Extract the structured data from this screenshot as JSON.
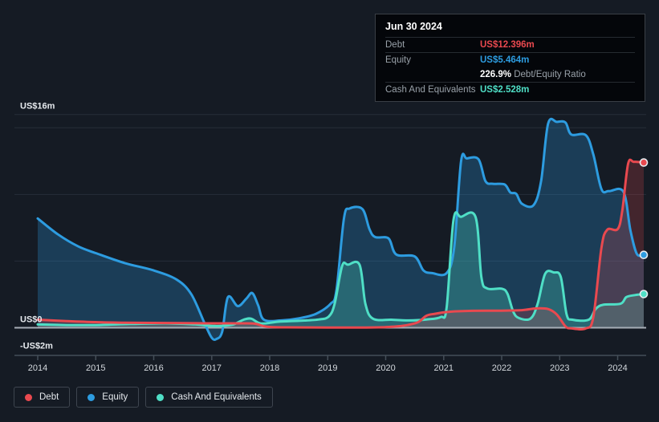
{
  "tooltip": {
    "date": "Jun 30 2024",
    "rows": [
      {
        "label": "Debt",
        "value": "US$12.396m"
      },
      {
        "label": "Equity",
        "value": "US$5.464m"
      },
      {
        "ratio_value": "226.9%",
        "ratio_label": "Debt/Equity Ratio"
      },
      {
        "label": "Cash And Equivalents",
        "value": "US$2.528m"
      }
    ]
  },
  "chart_data": {
    "type": "area",
    "unit": "US$ millions",
    "x_axis": {
      "ticks": [
        2014,
        2015,
        2016,
        2017,
        2018,
        2019,
        2020,
        2021,
        2022,
        2023,
        2024
      ],
      "range": [
        2014,
        2024.5
      ]
    },
    "y_axis": {
      "labels": [
        {
          "text": "US$16m",
          "value": 16
        },
        {
          "text": "US$0",
          "value": 0
        },
        {
          "text": "-US$2m",
          "value": -2
        }
      ],
      "gridline_values": [
        16,
        15,
        10,
        5
      ],
      "range": [
        -2.1,
        17.7
      ]
    },
    "legend_position": "bottom-left",
    "series": [
      {
        "name": "Debt",
        "color": "#e9494f",
        "points": [
          [
            2014,
            0.6
          ],
          [
            2014.5,
            0.5
          ],
          [
            2015,
            0.42
          ],
          [
            2015.5,
            0.38
          ],
          [
            2016,
            0.36
          ],
          [
            2016.5,
            0.35
          ],
          [
            2017,
            0.33
          ],
          [
            2017.5,
            0.33
          ],
          [
            2017.75,
            0.3
          ],
          [
            2017.95,
            0.07
          ],
          [
            2018.3,
            0.03
          ],
          [
            2019,
            0.02
          ],
          [
            2019.6,
            0.02
          ],
          [
            2020,
            0.05
          ],
          [
            2020.3,
            0.15
          ],
          [
            2020.55,
            0.4
          ],
          [
            2020.7,
            0.9
          ],
          [
            2020.85,
            1.05
          ],
          [
            2021.1,
            1.2
          ],
          [
            2021.5,
            1.27
          ],
          [
            2022,
            1.28
          ],
          [
            2022.35,
            1.32
          ],
          [
            2022.6,
            1.45
          ],
          [
            2022.8,
            1.4
          ],
          [
            2022.95,
            1.0
          ],
          [
            2023.1,
            0.1
          ],
          [
            2023.2,
            -0.05
          ],
          [
            2023.45,
            -0.05
          ],
          [
            2023.58,
            0.8
          ],
          [
            2023.72,
            6.0
          ],
          [
            2023.82,
            7.35
          ],
          [
            2024,
            7.4
          ],
          [
            2024.08,
            8.8
          ],
          [
            2024.18,
            12.3
          ],
          [
            2024.28,
            12.45
          ],
          [
            2024.45,
            12.396
          ]
        ]
      },
      {
        "name": "Equity",
        "color": "#2d9ce0",
        "points": [
          [
            2014,
            8.2
          ],
          [
            2014.35,
            7.0
          ],
          [
            2014.7,
            6.1
          ],
          [
            2015,
            5.6
          ],
          [
            2015.5,
            4.85
          ],
          [
            2016,
            4.3
          ],
          [
            2016.4,
            3.6
          ],
          [
            2016.65,
            2.5
          ],
          [
            2016.88,
            0.3
          ],
          [
            2017,
            -0.75
          ],
          [
            2017.08,
            -0.85
          ],
          [
            2017.18,
            -0.3
          ],
          [
            2017.28,
            2.3
          ],
          [
            2017.45,
            1.62
          ],
          [
            2017.6,
            2.2
          ],
          [
            2017.7,
            2.6
          ],
          [
            2017.8,
            1.7
          ],
          [
            2017.9,
            0.6
          ],
          [
            2018.2,
            0.55
          ],
          [
            2018.5,
            0.7
          ],
          [
            2018.8,
            1.05
          ],
          [
            2019.05,
            1.8
          ],
          [
            2019.15,
            2.8
          ],
          [
            2019.28,
            8.2
          ],
          [
            2019.38,
            8.95
          ],
          [
            2019.6,
            8.9
          ],
          [
            2019.72,
            7.4
          ],
          [
            2019.82,
            6.8
          ],
          [
            2020.05,
            6.7
          ],
          [
            2020.18,
            5.5
          ],
          [
            2020.5,
            5.35
          ],
          [
            2020.65,
            4.3
          ],
          [
            2020.8,
            4.1
          ],
          [
            2021.05,
            4.1
          ],
          [
            2021.18,
            6.0
          ],
          [
            2021.3,
            12.5
          ],
          [
            2021.4,
            12.7
          ],
          [
            2021.6,
            12.65
          ],
          [
            2021.72,
            11.0
          ],
          [
            2021.85,
            10.8
          ],
          [
            2022.05,
            10.75
          ],
          [
            2022.15,
            10.15
          ],
          [
            2022.25,
            10.05
          ],
          [
            2022.35,
            9.3
          ],
          [
            2022.55,
            9.2
          ],
          [
            2022.68,
            11.0
          ],
          [
            2022.8,
            15.3
          ],
          [
            2022.95,
            15.45
          ],
          [
            2023.1,
            15.4
          ],
          [
            2023.2,
            14.5
          ],
          [
            2023.45,
            14.45
          ],
          [
            2023.58,
            13.0
          ],
          [
            2023.72,
            10.4
          ],
          [
            2023.85,
            10.25
          ],
          [
            2024.1,
            10.2
          ],
          [
            2024.22,
            7.3
          ],
          [
            2024.33,
            5.55
          ],
          [
            2024.45,
            5.464
          ]
        ]
      },
      {
        "name": "Cash And Equivalents",
        "color": "#4fdfc6",
        "points": [
          [
            2014,
            0.25
          ],
          [
            2014.5,
            0.2
          ],
          [
            2015,
            0.2
          ],
          [
            2015.6,
            0.28
          ],
          [
            2016.2,
            0.33
          ],
          [
            2016.7,
            0.25
          ],
          [
            2017.05,
            0.13
          ],
          [
            2017.35,
            0.22
          ],
          [
            2017.55,
            0.6
          ],
          [
            2017.68,
            0.68
          ],
          [
            2017.85,
            0.32
          ],
          [
            2018.15,
            0.45
          ],
          [
            2018.5,
            0.52
          ],
          [
            2018.85,
            0.62
          ],
          [
            2019.02,
            0.85
          ],
          [
            2019.12,
            1.8
          ],
          [
            2019.25,
            4.65
          ],
          [
            2019.35,
            4.73
          ],
          [
            2019.55,
            4.72
          ],
          [
            2019.65,
            1.8
          ],
          [
            2019.78,
            0.68
          ],
          [
            2020.1,
            0.6
          ],
          [
            2020.4,
            0.55
          ],
          [
            2020.7,
            0.62
          ],
          [
            2020.95,
            0.8
          ],
          [
            2021.05,
            1.5
          ],
          [
            2021.17,
            8.1
          ],
          [
            2021.3,
            8.32
          ],
          [
            2021.55,
            8.3
          ],
          [
            2021.65,
            3.8
          ],
          [
            2021.75,
            2.95
          ],
          [
            2022,
            2.93
          ],
          [
            2022.1,
            2.55
          ],
          [
            2022.2,
            1.2
          ],
          [
            2022.3,
            0.72
          ],
          [
            2022.5,
            0.7
          ],
          [
            2022.62,
            1.8
          ],
          [
            2022.75,
            4.05
          ],
          [
            2022.9,
            4.15
          ],
          [
            2023.02,
            3.8
          ],
          [
            2023.12,
            1.0
          ],
          [
            2023.22,
            0.6
          ],
          [
            2023.5,
            0.6
          ],
          [
            2023.62,
            1.4
          ],
          [
            2023.75,
            1.72
          ],
          [
            2024.05,
            1.8
          ],
          [
            2024.15,
            2.3
          ],
          [
            2024.3,
            2.45
          ],
          [
            2024.45,
            2.528
          ]
        ]
      }
    ],
    "colors": {
      "background": "#151b24",
      "gridline": "#272e38",
      "zero_line": "#a7aeb6",
      "axis_line": "#454e58",
      "debt": "#e9494f",
      "equity": "#2d9ce0",
      "cash": "#4fdfc6"
    }
  }
}
